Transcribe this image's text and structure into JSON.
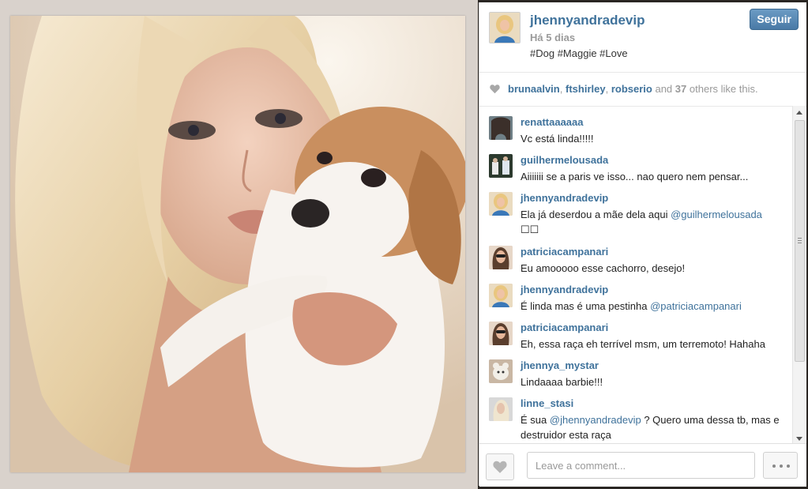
{
  "post": {
    "username": "jhennyandradevip",
    "time": "Há 5 dias",
    "caption": "#Dog #Maggie #Love",
    "follow_label": "Seguir"
  },
  "likes": {
    "user1": "brunaalvin",
    "sep1": ",",
    "user2": "ftshirley",
    "sep2": ",",
    "user3": "robserio",
    "and": "and",
    "count": "37",
    "suffix": "others like this."
  },
  "comments": [
    {
      "user": "renattaaaaaa",
      "text": "Vc está linda!!!!!"
    },
    {
      "user": "guilhermelousada",
      "text": "Aiiiiiii se a paris ve isso... nao quero nem pensar..."
    },
    {
      "user": "jhennyandradevip",
      "text": "Ela já deserdou a mãe dela aqui",
      "mention": "@guilhermelousada",
      "text_after": "",
      "line2": "☐☐"
    },
    {
      "user": "patriciacampanari",
      "text": "Eu amooooo esse cachorro, desejo!"
    },
    {
      "user": "jhennyandradevip",
      "text": "É linda mas é uma pestinha",
      "mention": "@patriciacampanari"
    },
    {
      "user": "patriciacampanari",
      "text": "Eh, essa raça eh terrível msm, um terremoto! Hahaha"
    },
    {
      "user": "jhennya_mystar",
      "text": "Lindaaaa barbie!!!"
    },
    {
      "user": "linne_stasi",
      "text": "É sua",
      "mention": "@jhennyandradevip",
      "text_after": " ? Quero uma dessa tb, mas e destruidor esta raça"
    }
  ],
  "footer": {
    "placeholder": "Leave a comment..."
  },
  "icons": {
    "like": "heart-icon",
    "more": "more-dots-icon",
    "likes_heart": "heart-icon"
  },
  "colors": {
    "link": "#3f729b",
    "follow_button": "#5a8ab5",
    "text": "#222222",
    "muted": "#999999"
  }
}
